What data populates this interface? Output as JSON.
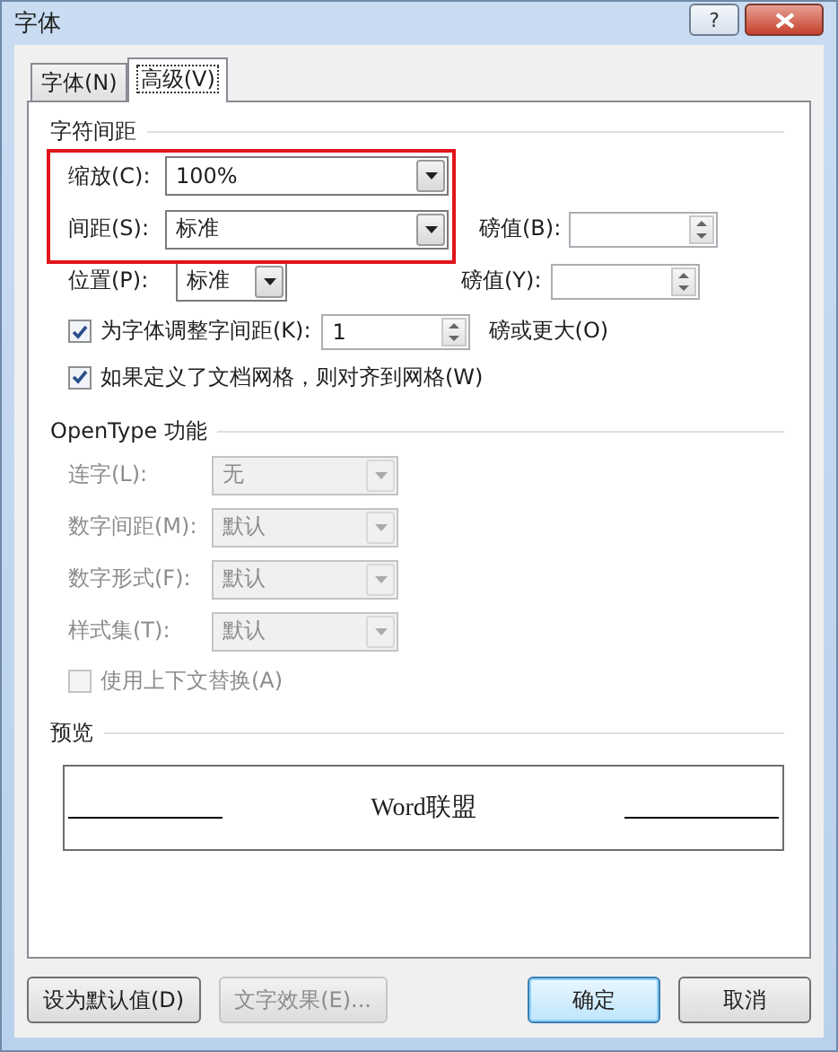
{
  "window": {
    "title": "字体",
    "help_button": "?"
  },
  "tabs": [
    {
      "label": "字体(N)",
      "selected": false
    },
    {
      "label": "高级(V)",
      "selected": true
    }
  ],
  "spacing": {
    "title": "字符间距",
    "highlight": true,
    "scale": {
      "label": "缩放(C):",
      "value": "100%"
    },
    "spacing": {
      "label": "间距(S):",
      "value": "标准"
    },
    "spacing_points": {
      "label": "磅值(B):"
    },
    "position": {
      "label": "位置(P):",
      "value": "标准"
    },
    "position_points": {
      "label": "磅值(Y):"
    },
    "kerning": {
      "label": "为字体调整字间距(K):",
      "checked": true,
      "value": "1",
      "suffix": "磅或更大(O)"
    },
    "snap_to_grid": {
      "label": "如果定义了文档网格，则对齐到网格(W)",
      "checked": true
    }
  },
  "opentype": {
    "title": "OpenType 功能",
    "fields": [
      {
        "label": "连字(L):",
        "value": "无",
        "disabled": true
      },
      {
        "label": "数字间距(M):",
        "value": "默认",
        "disabled": true
      },
      {
        "label": "数字形式(F):",
        "value": "默认",
        "disabled": true
      },
      {
        "label": "样式集(T):",
        "value": "默认",
        "disabled": true
      }
    ],
    "contextual_alternates": {
      "label": "使用上下文替换(A)",
      "checked": false,
      "disabled": true
    }
  },
  "preview": {
    "title": "预览",
    "text": "Word联盟"
  },
  "buttons": {
    "left": [
      {
        "label": "设为默认值(D)",
        "disabled": false,
        "default": false
      },
      {
        "label": "文字效果(E)...",
        "disabled": true,
        "default": false
      }
    ],
    "right": [
      {
        "label": "确定",
        "disabled": false,
        "default": true
      },
      {
        "label": "取消",
        "disabled": false,
        "default": false
      }
    ]
  }
}
